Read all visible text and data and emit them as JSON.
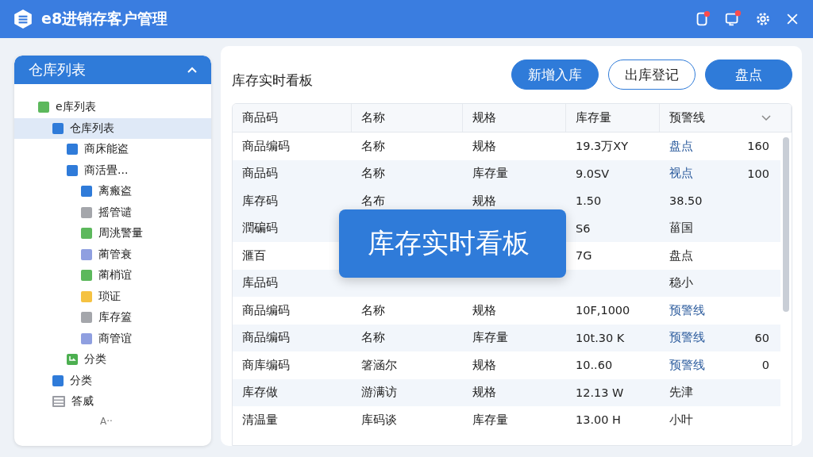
{
  "window": {
    "title": "e8进销存客户管理"
  },
  "sidebar": {
    "title": "仓库列表",
    "expanded": true,
    "tree": [
      {
        "label": "e库列表",
        "color": "#5cb85c",
        "kind": "square",
        "selected": false,
        "children": [
          {
            "label": "仓库列表",
            "color": "#2f7bd9",
            "kind": "square",
            "selected": true,
            "children": [
              {
                "label": "商床能盗",
                "color": "#2f7bd9",
                "kind": "square",
                "selected": false
              },
              {
                "label": "商活畳...",
                "color": "#2f7bd9",
                "kind": "square",
                "selected": false,
                "children": [
                  {
                    "label": "离瘢盗",
                    "color": "#2f7bd9",
                    "kind": "square",
                    "selected": false
                  },
                  {
                    "label": "摇管谴",
                    "color": "#a4a6ab",
                    "kind": "square",
                    "selected": false
                  },
                  {
                    "label": "周洮警量",
                    "color": "#5cb85c",
                    "kind": "square",
                    "selected": false
                  },
                  {
                    "label": "蔺管衰",
                    "color": "#8f9fe0",
                    "kind": "square",
                    "selected": false
                  },
                  {
                    "label": "蔺梢谊",
                    "color": "#5cb85c",
                    "kind": "square",
                    "selected": false
                  },
                  {
                    "label": "琐证",
                    "color": "#f5c242",
                    "kind": "square",
                    "selected": false
                  },
                  {
                    "label": "库存篕",
                    "color": "#a4a6ab",
                    "kind": "square",
                    "selected": false
                  },
                  {
                    "label": "商管谊",
                    "color": "#8f9fe0",
                    "kind": "square",
                    "selected": false
                  }
                ]
              },
              {
                "label": "分类",
                "color": "#4caf50",
                "kind": "folder",
                "selected": false
              }
            ]
          },
          {
            "label": "分类",
            "color": "#2f7bd9",
            "kind": "square",
            "selected": false
          },
          {
            "label": "答威",
            "color": "#9a9ca3",
            "kind": "list",
            "selected": false
          }
        ]
      }
    ],
    "more": "A··"
  },
  "board": {
    "title": "库存实时看板",
    "buttons": [
      {
        "label": "新增入库",
        "kind": "primary"
      },
      {
        "label": "出库登记",
        "kind": "outline"
      },
      {
        "label": "盘点",
        "kind": "primary"
      }
    ],
    "table": {
      "columns": [
        "商品码",
        "名称",
        "规格",
        "库存量",
        "预警线"
      ],
      "rows": [
        {
          "shaded": false,
          "cells": [
            "商品编码",
            "名称",
            "规格",
            "19.3万XY"
          ],
          "warn": "盘点",
          "warn_link": true,
          "extra": "160"
        },
        {
          "shaded": true,
          "cells": [
            "商品码",
            "名称",
            "库存量",
            "9.0SV"
          ],
          "warn": "视点",
          "warn_link": true,
          "extra": "100"
        },
        {
          "shaded": true,
          "cells": [
            "库存码",
            "名布",
            "规格",
            "1.50"
          ],
          "warn": "38.50",
          "warn_link": false
        },
        {
          "shaded": true,
          "cells": [
            "潤碥码",
            "",
            "",
            "S6"
          ],
          "warn": "菑国",
          "warn_link": false
        },
        {
          "shaded": false,
          "cells": [
            "滙百",
            "",
            "",
            "7G"
          ],
          "warn": "盘点",
          "warn_link": false
        },
        {
          "shaded": true,
          "cells": [
            "库品码",
            "",
            "",
            ""
          ],
          "warn": "稳小",
          "warn_link": false
        },
        {
          "shaded": false,
          "cells": [
            "商品编码",
            "名称",
            "规格",
            "10F,1000"
          ],
          "warn": "预警线",
          "warn_link": true
        },
        {
          "shaded": true,
          "cells": [
            "商品编码",
            "名称",
            "库存量",
            "10t.30 K"
          ],
          "warn": "预警线",
          "warn_link": true,
          "extra": "60"
        },
        {
          "shaded": false,
          "cells": [
            "商库编码",
            "箸涵尔",
            "规格",
            "10..60"
          ],
          "warn": "预警线",
          "warn_link": true,
          "extra": "0"
        },
        {
          "shaded": true,
          "cells": [
            "库存做",
            "游满访",
            "规格",
            "12.13 W"
          ],
          "warn": "先津",
          "warn_link": false
        },
        {
          "shaded": false,
          "cells": [
            "清温量",
            "库码谈",
            "库存量",
            "13.00 H"
          ],
          "warn": "小叶",
          "warn_link": false
        }
      ]
    },
    "toast": "库存实时看板"
  }
}
